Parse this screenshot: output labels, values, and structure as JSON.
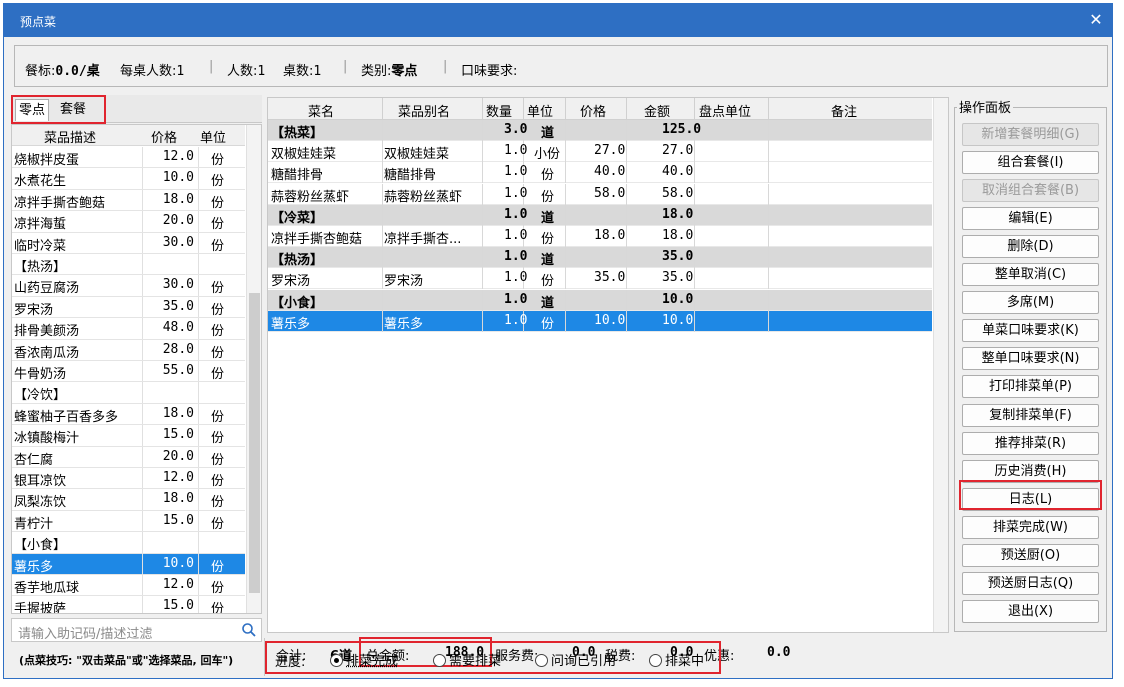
{
  "window": {
    "title": "预点菜",
    "close_glyph": "✕"
  },
  "info": {
    "standard_label": "餐标:",
    "standard_value": "0.0/桌",
    "per_table_label": "每桌人数:",
    "per_table_value": "1",
    "people_label": "人数:",
    "people_value": "1",
    "tables_label": "桌数:",
    "tables_value": "1",
    "category_label": "类别:",
    "category_value": "零点",
    "taste_label": "口味要求:",
    "sep": "|"
  },
  "left": {
    "tabs": [
      "零点",
      "套餐"
    ],
    "headers": [
      "菜品描述",
      "价格",
      "单位"
    ],
    "items": [
      {
        "name": "烧椒拌皮蛋",
        "price": "12.0",
        "unit": "份"
      },
      {
        "name": "水煮花生",
        "price": "10.0",
        "unit": "份"
      },
      {
        "name": "凉拌手撕杏鲍菇",
        "price": "18.0",
        "unit": "份"
      },
      {
        "name": "凉拌海蜇",
        "price": "20.0",
        "unit": "份"
      },
      {
        "name": "临时冷菜",
        "price": "30.0",
        "unit": "份"
      },
      {
        "name": "【热汤】",
        "price": "",
        "unit": ""
      },
      {
        "name": "山药豆腐汤",
        "price": "30.0",
        "unit": "份"
      },
      {
        "name": "罗宋汤",
        "price": "35.0",
        "unit": "份"
      },
      {
        "name": "排骨美颜汤",
        "price": "48.0",
        "unit": "份"
      },
      {
        "name": "香浓南瓜汤",
        "price": "28.0",
        "unit": "份"
      },
      {
        "name": "牛骨奶汤",
        "price": "55.0",
        "unit": "份"
      },
      {
        "name": "【冷饮】",
        "price": "",
        "unit": ""
      },
      {
        "name": "蜂蜜柚子百香多多",
        "price": "18.0",
        "unit": "份"
      },
      {
        "name": "冰镇酸梅汁",
        "price": "15.0",
        "unit": "份"
      },
      {
        "name": "杏仁腐",
        "price": "20.0",
        "unit": "份"
      },
      {
        "name": "银耳凉饮",
        "price": "12.0",
        "unit": "份"
      },
      {
        "name": "凤梨冻饮",
        "price": "18.0",
        "unit": "份"
      },
      {
        "name": "青柠汁",
        "price": "15.0",
        "unit": "份"
      },
      {
        "name": "【小食】",
        "price": "",
        "unit": ""
      },
      {
        "name": "薯乐多",
        "price": "10.0",
        "unit": "份"
      },
      {
        "name": "香芋地瓜球",
        "price": "12.0",
        "unit": "份"
      },
      {
        "name": "手握披萨",
        "price": "15.0",
        "unit": "份"
      }
    ],
    "selected_index": 19,
    "filter_placeholder": "请输入助记码/描述过滤",
    "tip": "(点菜技巧: \"双击菜品\"或\"选择菜品, 回车\")"
  },
  "grid": {
    "headers": [
      "菜名",
      "菜品别名",
      "数量",
      "单位",
      "价格",
      "金额",
      "盘点单位",
      "备注"
    ],
    "rows": [
      {
        "type": "group",
        "name": "【热菜】",
        "alias": "",
        "qty": "3.0",
        "unit": "道",
        "price": "",
        "amount": "125.0"
      },
      {
        "type": "item",
        "name": "双椒娃娃菜",
        "alias": "双椒娃娃菜",
        "qty": "1.0",
        "unit": "小份",
        "price": "27.0",
        "amount": "27.0"
      },
      {
        "type": "item",
        "name": "糖醋排骨",
        "alias": "糖醋排骨",
        "qty": "1.0",
        "unit": "份",
        "price": "40.0",
        "amount": "40.0"
      },
      {
        "type": "item",
        "name": "蒜蓉粉丝蒸虾",
        "alias": "蒜蓉粉丝蒸虾",
        "qty": "1.0",
        "unit": "份",
        "price": "58.0",
        "amount": "58.0"
      },
      {
        "type": "group",
        "name": "【冷菜】",
        "alias": "",
        "qty": "1.0",
        "unit": "道",
        "price": "",
        "amount": "18.0"
      },
      {
        "type": "item",
        "name": "凉拌手撕杏鲍菇",
        "alias": "凉拌手撕杏...",
        "qty": "1.0",
        "unit": "份",
        "price": "18.0",
        "amount": "18.0"
      },
      {
        "type": "group",
        "name": "【热汤】",
        "alias": "",
        "qty": "1.0",
        "unit": "道",
        "price": "",
        "amount": "35.0"
      },
      {
        "type": "item",
        "name": "罗宋汤",
        "alias": "罗宋汤",
        "qty": "1.0",
        "unit": "份",
        "price": "35.0",
        "amount": "35.0"
      },
      {
        "type": "group",
        "name": "【小食】",
        "alias": "",
        "qty": "1.0",
        "unit": "道",
        "price": "",
        "amount": "10.0"
      },
      {
        "type": "sel",
        "name": "薯乐多",
        "alias": "薯乐多",
        "qty": "1.0",
        "unit": "份",
        "price": "10.0",
        "amount": "10.0"
      }
    ]
  },
  "totals": {
    "sum_label": "合计:",
    "sum_value": "6道",
    "total_label": "总金额:",
    "total_value": "188.0",
    "service_label": "服务费:",
    "service_value": "0.0",
    "tax_label": "税费:",
    "tax_value": "0.0",
    "discount_label": "优惠:",
    "discount_value": "0.0"
  },
  "panel": {
    "legend": "操作面板",
    "buttons": [
      {
        "label": "新增套餐明细(G)",
        "enabled": false
      },
      {
        "label": "组合套餐(I)",
        "enabled": true
      },
      {
        "label": "取消组合套餐(B)",
        "enabled": false
      },
      {
        "label": "编辑(E)",
        "enabled": true
      },
      {
        "label": "删除(D)",
        "enabled": true
      },
      {
        "label": "整单取消(C)",
        "enabled": true
      },
      {
        "label": "多席(M)",
        "enabled": true
      },
      {
        "label": "单菜口味要求(K)",
        "enabled": true
      },
      {
        "label": "整单口味要求(N)",
        "enabled": true
      },
      {
        "label": "打印排菜单(P)",
        "enabled": true
      },
      {
        "label": "复制排菜单(F)",
        "enabled": true
      },
      {
        "label": "推荐排菜(R)",
        "enabled": true
      },
      {
        "label": "历史消费(H)",
        "enabled": true
      },
      {
        "label": "日志(L)",
        "enabled": true
      },
      {
        "label": "排菜完成(W)",
        "enabled": true
      },
      {
        "label": "预送厨(O)",
        "enabled": true
      },
      {
        "label": "预送厨日志(Q)",
        "enabled": true
      },
      {
        "label": "退出(X)",
        "enabled": true
      }
    ]
  },
  "progress": {
    "label": "进度:",
    "options": [
      "排菜完成",
      "需要排菜",
      "问询已引用",
      "排菜中"
    ],
    "selected": 0
  },
  "colors": {
    "titlebar": "#2e6fc3",
    "selection": "#1e88e5",
    "highlight": "#e0242e",
    "group_row": "#d9d9d9"
  }
}
